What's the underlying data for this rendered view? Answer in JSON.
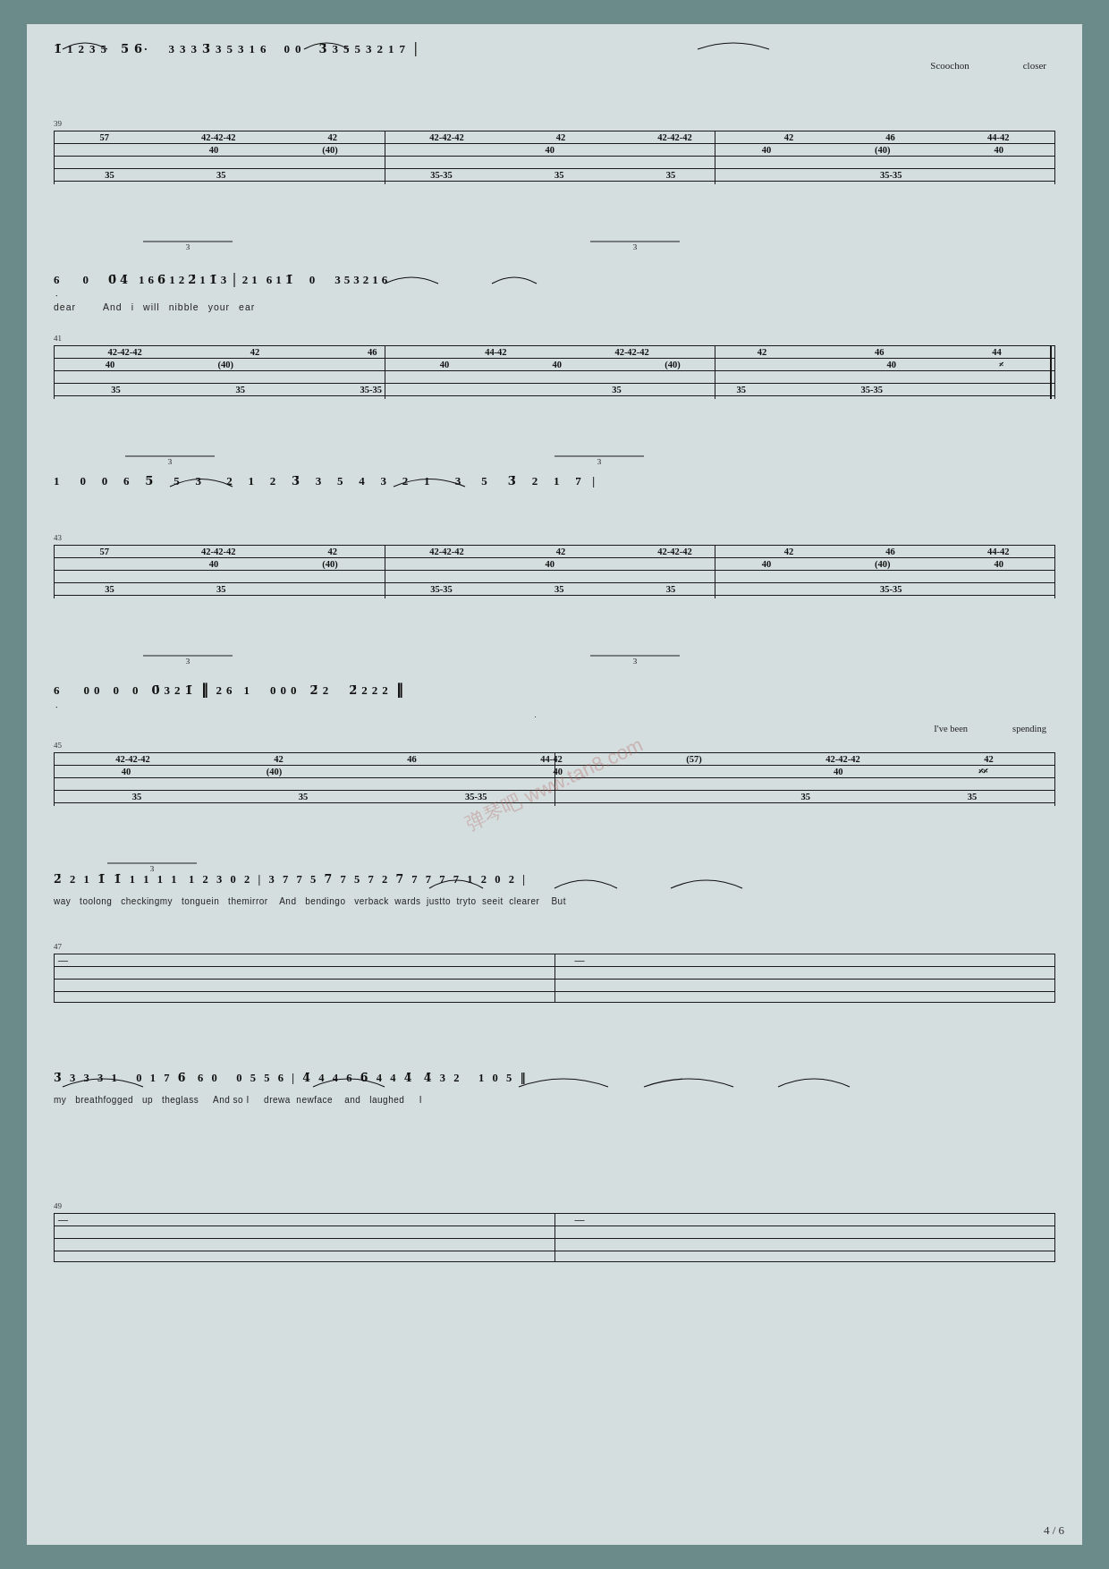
{
  "page": {
    "number": "4 / 6",
    "watermark": "弹琴吧 www.tan8.com",
    "background": "#6b8a8a",
    "paper": "#d4dede"
  },
  "sections": {
    "top_numbers": "1  1  2  3  5      5  6·      3  3  3  3  3  5  3  1  6      0  0      3  3  5  5  3  2  1  7",
    "top_lyrics_right": "Scoochon         closer",
    "sec3_numbers": "6      0      0  4    1  6  6   1  2  2   1  1  3  |  2  1    6  1  1      0    3  5  3  2  1  6",
    "sec3_lyrics": "dear           And   i   will   nibble   your   ear",
    "sec5_numbers": "1      0  0  6  5    5  3      2  1  2  3   3  5  4  3  2  1      3    5    3  2  1  7",
    "sec7_numbers": "6         0  0      0      0      0  3  2  1      2  6    1      0  0  0    2  2         2  2  2  2",
    "sec7_lyrics_right": "I've been         spending",
    "sec9_numbers": "2  2  1  1  1  1  1  1  1   1  2  3  0  2  |  3  7  7  5   7  7  5  7  2   7  7  7  7  7  1  2  0  2",
    "sec9_lyrics": "way  toolong  checkingmy  tonguein  themirror    And  bendingo  verback  wards  justto  tryto  seeit  clearer    But",
    "sec11_numbers": "3  3  3  3  1      0  1  7  6    6  0      0  5  5  6  |  4  4  4  6  6  4  4  4   4  3  2      1  0  5",
    "sec11_lyrics": "my  breathfogged  up  theglass    And so I    drewa  newface   and  laughed    I"
  }
}
